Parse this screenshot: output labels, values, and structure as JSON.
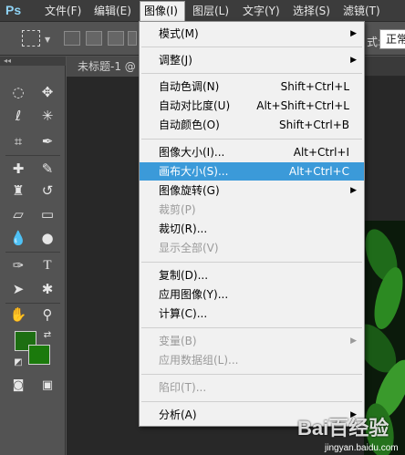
{
  "app": {
    "logo": "Ps"
  },
  "menubar": {
    "items": [
      {
        "label": "文件(F)"
      },
      {
        "label": "编辑(E)"
      },
      {
        "label": "图像(I)"
      },
      {
        "label": "图层(L)"
      },
      {
        "label": "文字(Y)"
      },
      {
        "label": "选择(S)"
      },
      {
        "label": "滤镜(T)"
      }
    ]
  },
  "options_bar": {
    "label": "式:",
    "select_value": "正常"
  },
  "document": {
    "tab_title": "未标题-1 @"
  },
  "image_menu": {
    "items": [
      {
        "label": "模式(M)",
        "submenu": true
      },
      {
        "label": "调整(J)",
        "submenu": true
      },
      {
        "label": "自动色调(N)",
        "shortcut": "Shift+Ctrl+L"
      },
      {
        "label": "自动对比度(U)",
        "shortcut": "Alt+Shift+Ctrl+L"
      },
      {
        "label": "自动颜色(O)",
        "shortcut": "Shift+Ctrl+B"
      },
      {
        "label": "图像大小(I)...",
        "shortcut": "Alt+Ctrl+I"
      },
      {
        "label": "画布大小(S)...",
        "shortcut": "Alt+Ctrl+C",
        "highlighted": true
      },
      {
        "label": "图像旋转(G)",
        "submenu": true
      },
      {
        "label": "裁剪(P)",
        "disabled": true
      },
      {
        "label": "裁切(R)..."
      },
      {
        "label": "显示全部(V)",
        "disabled": true
      },
      {
        "label": "复制(D)..."
      },
      {
        "label": "应用图像(Y)..."
      },
      {
        "label": "计算(C)..."
      },
      {
        "label": "变量(B)",
        "submenu": true,
        "disabled": true
      },
      {
        "label": "应用数据组(L)...",
        "disabled": true
      },
      {
        "label": "陷印(T)...",
        "disabled": true
      },
      {
        "label": "分析(A)",
        "submenu": true
      }
    ]
  },
  "colors": {
    "foreground": "#1d6e12",
    "background": "#1b7a0c",
    "highlight": "#3b9ad9"
  },
  "watermark": {
    "text": "Bai百经验",
    "url": "jingyan.baidu.com"
  }
}
